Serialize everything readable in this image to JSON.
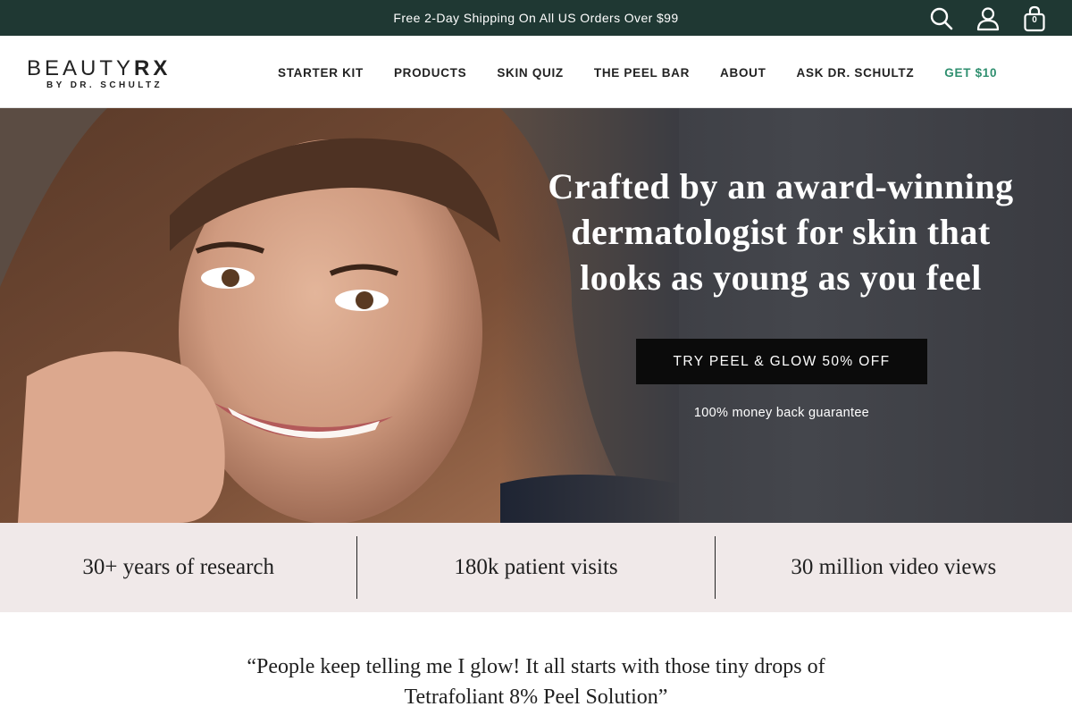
{
  "announcement": {
    "text": "Free 2-Day Shipping On All US Orders Over $99",
    "cart_count": "0",
    "icons": [
      "search-icon",
      "account-icon",
      "cart-icon"
    ]
  },
  "logo": {
    "main": "BEAUTY",
    "rx": "RX",
    "sub": "BY DR. SCHULTZ"
  },
  "nav": {
    "items": [
      {
        "label": "STARTER KIT"
      },
      {
        "label": "PRODUCTS"
      },
      {
        "label": "SKIN QUIZ"
      },
      {
        "label": "THE PEEL BAR"
      },
      {
        "label": "ABOUT"
      },
      {
        "label": "ASK DR. SCHULTZ"
      },
      {
        "label": "GET $10"
      }
    ]
  },
  "hero": {
    "title": "Crafted by an award-winning dermatologist for skin that looks as young as you feel",
    "cta_label": "TRY PEEL & GLOW 50% OFF",
    "guarantee": "100% money back guarantee"
  },
  "stats": [
    {
      "text": "30+ years of research"
    },
    {
      "text": "180k patient visits"
    },
    {
      "text": "30 million video views"
    }
  ],
  "testimonial": {
    "quote": "“People keep telling me I glow! It all starts with those tiny drops of Tetrafoliant 8% Peel Solution”"
  },
  "colors": {
    "announcement_bg": "#1f3833",
    "promo_link": "#2f8f6f",
    "stats_bg": "#f0e9e9",
    "cta_bg": "#0b0b0b"
  }
}
